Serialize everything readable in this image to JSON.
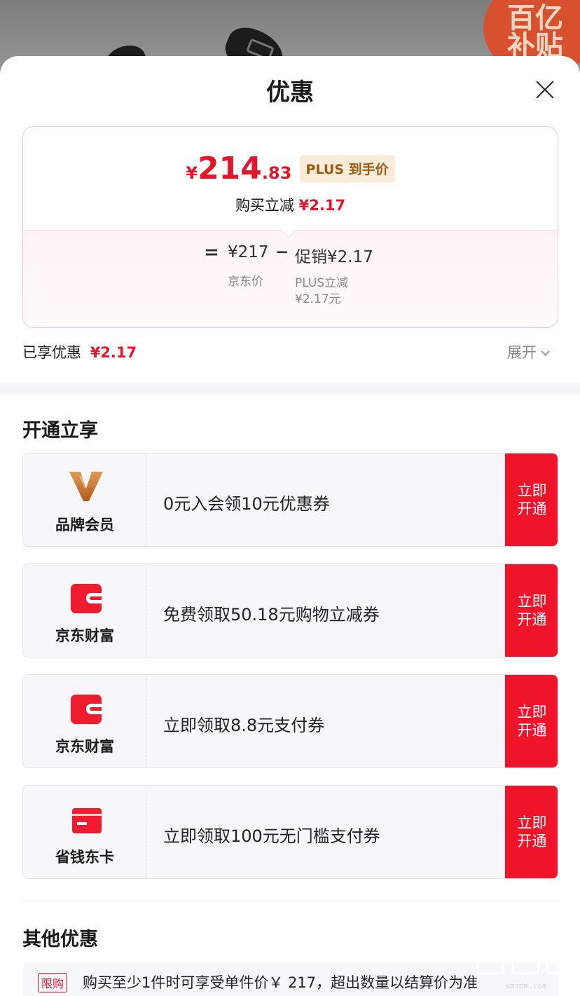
{
  "background": {
    "badge_line1": "百亿",
    "badge_line2": "补贴"
  },
  "sheet": {
    "title": "优惠",
    "close_icon": "close-icon"
  },
  "price_card": {
    "yen": "¥",
    "price_int": "214",
    "price_dec": ".83",
    "plus_tag": "PLUS 到手价",
    "reduce_label": "购买立减",
    "reduce_amount": "¥2.17",
    "formula": {
      "equals": "=",
      "base_price": "¥217",
      "base_label": "京东价",
      "minus": "−",
      "promo": "促销¥2.17",
      "promo_sub1": "PLUS立减",
      "promo_sub2": "¥2.17元"
    }
  },
  "enjoy": {
    "label": "已享优惠",
    "amount": "¥2.17",
    "expand": "展开"
  },
  "open_section": {
    "title": "开通立享",
    "button_line1": "立即",
    "button_line2": "开通",
    "cards": [
      {
        "brand": "品牌会员",
        "icon": "brand-v-icon",
        "desc": "0元入会领10元优惠券"
      },
      {
        "brand": "京东财富",
        "icon": "wallet-icon",
        "desc": "免费领取50.18元购物立减券"
      },
      {
        "brand": "京东财富",
        "icon": "wallet-icon",
        "desc": "立即领取8.8元支付券"
      },
      {
        "brand": "省钱东卡",
        "icon": "card-icon",
        "desc": "立即领取100元无门槛支付券"
      }
    ]
  },
  "other_section": {
    "title": "其他优惠",
    "limit_tag": "限购",
    "limit_text": "购买至少1件时可享受单件价￥ 217，超出数量以结算价为准"
  },
  "watermark": {
    "text": "值值值",
    "sub": "smzdm.com"
  },
  "colors": {
    "accent": "#e4162b",
    "button": "#f0142b",
    "plus_tag_bg": "#fbecd9",
    "plus_tag_text": "#9c5a12"
  }
}
